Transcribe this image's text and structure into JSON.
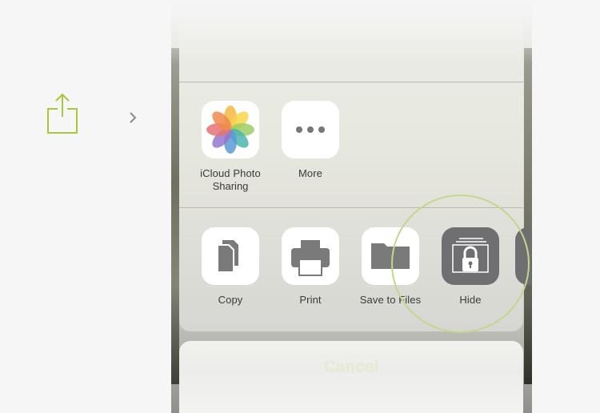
{
  "colors": {
    "accent_green": "#a8c83c",
    "highlight_ring": "#c3d78a",
    "hide_tile": "#6f6f72",
    "glyph_gray": "#7a7a7a"
  },
  "share_button": {
    "icon": "share-icon"
  },
  "chevron": {
    "icon": "chevron-right-icon"
  },
  "share_sheet": {
    "app_row": [
      {
        "label_line1": "iCloud Photo",
        "label_line2": "Sharing",
        "icon": "photos-icon"
      },
      {
        "label_line1": "More",
        "label_line2": "",
        "icon": "more-icon"
      }
    ],
    "action_row": [
      {
        "label": "Copy",
        "icon": "copy-icon"
      },
      {
        "label": "Print",
        "icon": "printer-icon"
      },
      {
        "label": "Save to Files",
        "icon": "folder-icon"
      },
      {
        "label": "Hide",
        "icon": "hide-lock-icon"
      }
    ]
  },
  "cancel": {
    "label": "Cancel"
  }
}
